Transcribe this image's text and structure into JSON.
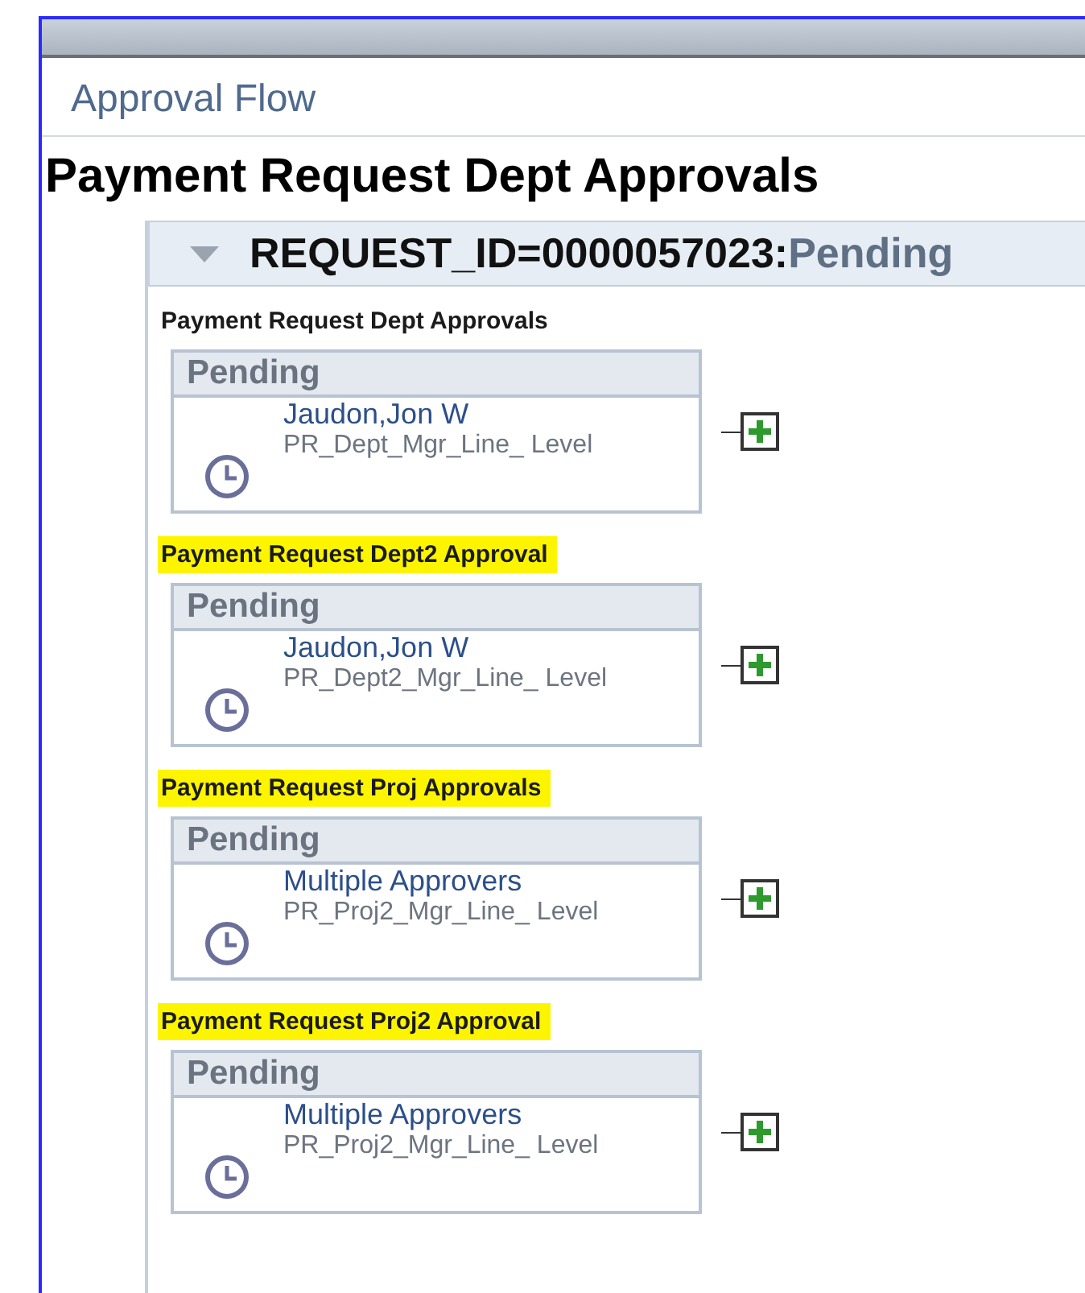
{
  "page_tab": "Approval Flow",
  "title": "Payment Request Dept Approvals",
  "request": {
    "expanded": true,
    "id_label": "REQUEST_ID=0000057023:",
    "status": "Pending"
  },
  "stages": [
    {
      "title": "Payment Request Dept Approvals",
      "highlighted": false,
      "step": {
        "status": "Pending",
        "approver": "Jaudon,Jon W",
        "rule": "PR_Dept_Mgr_Line_ Level"
      }
    },
    {
      "title": "Payment Request Dept2 Approval",
      "highlighted": true,
      "step": {
        "status": "Pending",
        "approver": "Jaudon,Jon W",
        "rule": "PR_Dept2_Mgr_Line_ Level"
      }
    },
    {
      "title": "Payment Request Proj Approvals",
      "highlighted": true,
      "step": {
        "status": "Pending",
        "approver": "Multiple Approvers",
        "rule": "PR_Proj2_Mgr_Line_ Level"
      }
    },
    {
      "title": "Payment Request Proj2 Approval",
      "highlighted": true,
      "step": {
        "status": "Pending",
        "approver": "Multiple Approvers",
        "rule": "PR_Proj2_Mgr_Line_ Level"
      }
    }
  ]
}
